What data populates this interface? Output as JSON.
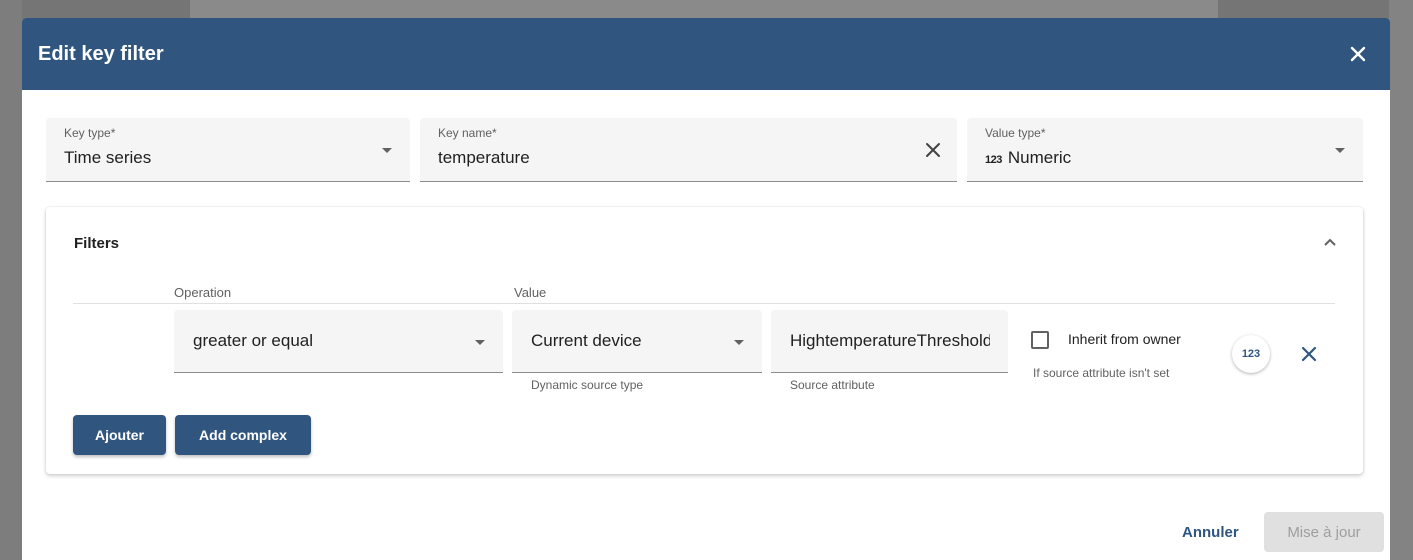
{
  "dialog": {
    "title": "Edit key filter"
  },
  "key_type": {
    "label": "Key type*",
    "value": "Time series"
  },
  "key_name": {
    "label": "Key name*",
    "value": "temperature"
  },
  "value_type": {
    "label": "Value type*",
    "badge": "123",
    "value": "Numeric"
  },
  "filters": {
    "title": "Filters",
    "columns": {
      "operation": "Operation",
      "value": "Value"
    },
    "row": {
      "operation": "greater or equal",
      "source_type": "Current device",
      "source_type_hint": "Dynamic source type",
      "source_attribute": "HightemperatureThreshold",
      "source_attribute_hint": "Source attribute",
      "inherit_label": "Inherit from owner",
      "inherit_hint": "If source attribute isn't set",
      "type_badge": "123"
    },
    "add_label": "Ajouter",
    "add_complex_label": "Add complex"
  },
  "actions": {
    "cancel": "Annuler",
    "update": "Mise à jour"
  },
  "colors": {
    "primary": "#305680",
    "field_bg": "#f5f5f5"
  }
}
